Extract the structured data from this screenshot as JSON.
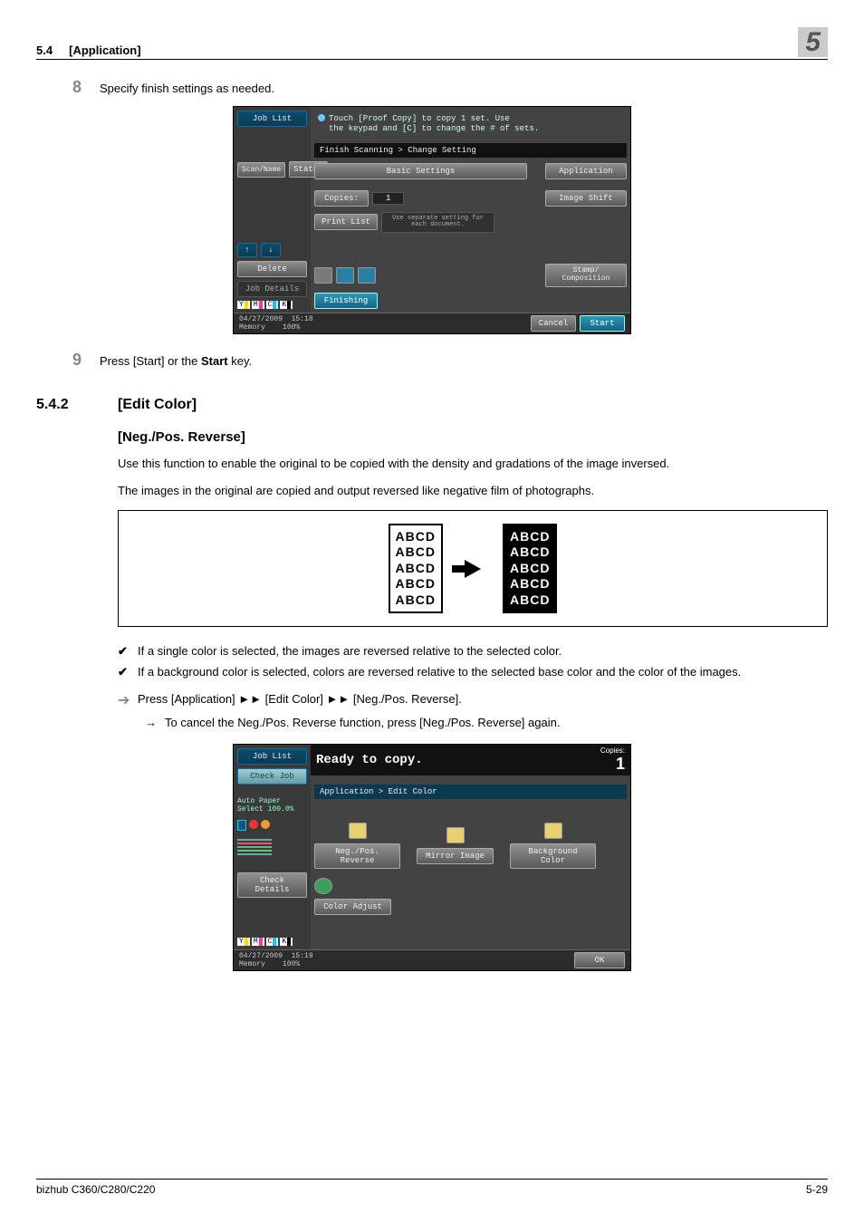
{
  "header": {
    "section_num": "5.4",
    "section_title": "[Application]",
    "chapter_num": "5"
  },
  "footer": {
    "product": "bizhub C360/C280/C220",
    "page_num": "5-29"
  },
  "step8": {
    "num": "8",
    "text": "Specify finish settings as needed."
  },
  "panel1": {
    "job_list": "Job List",
    "msg1": "Touch [Proof Copy] to copy 1 set. Use",
    "msg2": "the keypad and [C] to change the # of sets.",
    "breadcrumb": "Finish Scanning > Change Setting",
    "basic_settings": "Basic Settings",
    "application": "Application",
    "sort": "Scan/Name",
    "status": "Status",
    "copies": "Copies:",
    "copies_val": "1",
    "image_shift": "Image Shift",
    "print_list": "Print List",
    "sep_setting": "Use separate setting for each document.",
    "stamp": "Stamp/\nComposition",
    "delete": "Delete",
    "finishing": "Finishing",
    "job_details": "Job Details",
    "date": "04/27/2009",
    "time": "15:18",
    "mem": "Memory",
    "mempct": "100%",
    "cancel": "Cancel",
    "start": "Start"
  },
  "step9": {
    "num": "9",
    "text_pre": "Press [Start] or the ",
    "text_bold": "Start",
    "text_post": " key."
  },
  "heading": {
    "num": "5.4.2",
    "title": "[Edit Color]"
  },
  "subheading": "[Neg./Pos. Reverse]",
  "para1": "Use this function to enable the original to be copied with the density and gradations of the image inversed.",
  "para2": "The images in the original are copied and output reversed like negative film of photographs.",
  "abcd": [
    "ABCD",
    "ABCD",
    "ABCD",
    "ABCD",
    "ABCD"
  ],
  "bullet1": "If a single color is selected, the images are reversed relative to the selected color.",
  "bullet2": "If a background color is selected, colors are reversed relative to the selected base color and the color of the images.",
  "arrowline": "Press [Application] ►► [Edit Color] ►► [Neg./Pos. Reverse].",
  "subarrow": "To cancel the Neg./Pos. Reverse function, press [Neg./Pos. Reverse] again.",
  "panel2": {
    "job_list": "Job List",
    "ready": "Ready to copy.",
    "copies_lbl": "Copies:",
    "copies_val": "1",
    "check_job": "Check Job",
    "breadcrumb": "Application > Edit Color",
    "auto_paper": "Auto Paper Select",
    "zoom": "100.0%",
    "negpos": "Neg./Pos. Reverse",
    "mirror": "Mirror Image",
    "bgcolor": "Background Color",
    "color_adj": "Color Adjust",
    "check_details": "Check Details",
    "date": "04/27/2009",
    "time": "15:19",
    "mem": "Memory",
    "mempct": "100%",
    "ok": "OK"
  }
}
